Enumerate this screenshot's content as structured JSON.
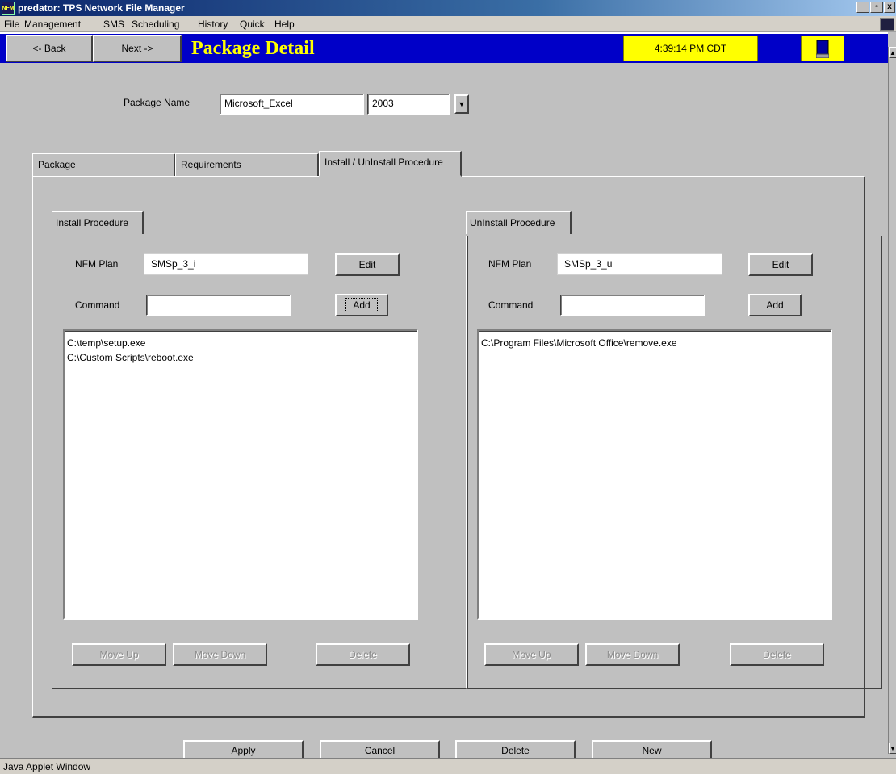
{
  "window": {
    "app_icon_text": "NFM",
    "title": "predator: TPS Network File Manager",
    "minimize": "_",
    "maximize": "▫",
    "close": "x"
  },
  "menu": [
    "File",
    "Management",
    "SMS",
    "Scheduling",
    "History",
    "Quick",
    "Help"
  ],
  "toolbar": {
    "back_label": "<- Back",
    "next_label": "Next ->",
    "page_title": "Package Detail",
    "clock": "4:39:14 PM CDT",
    "accent_color": "#0000c8",
    "highlight_color": "#ffff00"
  },
  "package": {
    "name_label": "Package Name",
    "name_value": "Microsoft_Excel",
    "version_value": "2003"
  },
  "tabs": [
    {
      "label": "Package"
    },
    {
      "label": "Requirements"
    },
    {
      "label": "Install / UnInstall Procedure"
    }
  ],
  "install": {
    "tab_label": "Install Procedure",
    "plan_label": "NFM Plan",
    "plan_value": "SMSp_3_i",
    "edit_label": "Edit",
    "command_label": "Command",
    "command_value": "",
    "add_label": "Add",
    "commands": [
      "C:\\temp\\setup.exe",
      "C:\\Custom Scripts\\reboot.exe"
    ],
    "move_up_label": "Move Up",
    "move_down_label": "Move Down",
    "delete_label": "Delete"
  },
  "uninstall": {
    "tab_label": "UnInstall Procedure",
    "plan_label": "NFM Plan",
    "plan_value": "SMSp_3_u",
    "edit_label": "Edit",
    "command_label": "Command",
    "command_value": "",
    "add_label": "Add",
    "commands": [
      "C:\\Program Files\\Microsoft Office\\remove.exe"
    ],
    "move_up_label": "Move Up",
    "move_down_label": "Move Down",
    "delete_label": "Delete"
  },
  "footer": {
    "apply_label": "Apply",
    "cancel_label": "Cancel",
    "delete_label": "Delete",
    "new_label": "New"
  },
  "statusbar": "Java Applet Window"
}
